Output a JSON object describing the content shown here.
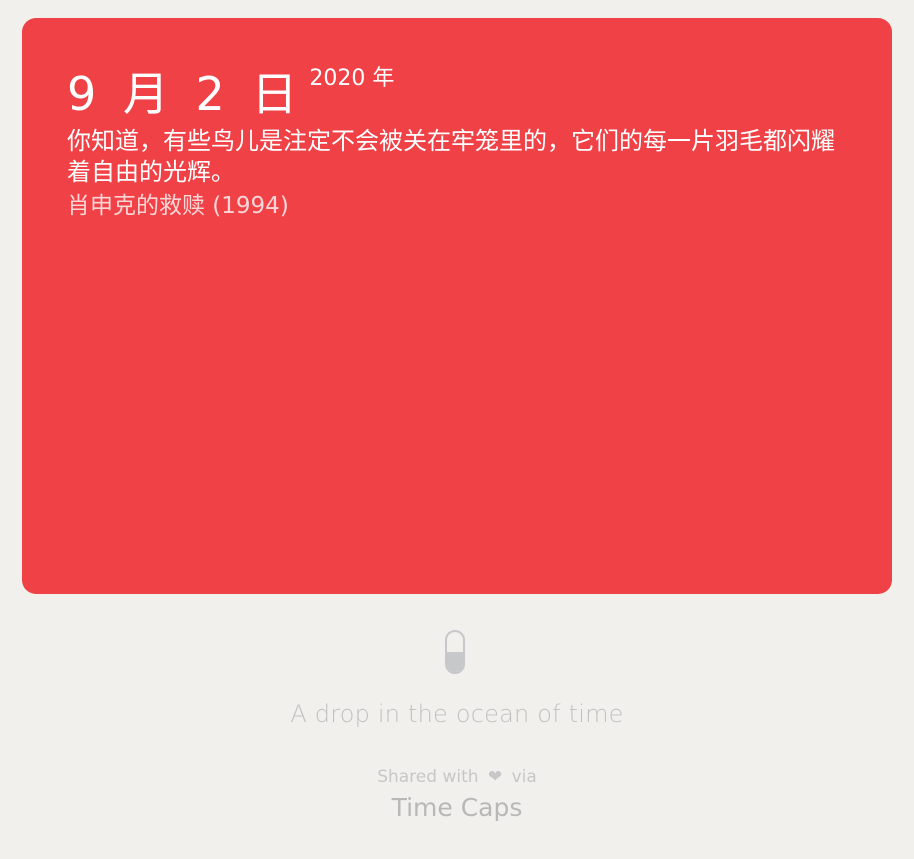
{
  "card": {
    "background": "#ef4146",
    "date": {
      "main": "9 月 2 日",
      "year": "2020 年"
    },
    "quote": "你知道，有些鸟儿是注定不会被关在牢笼里的，它们的每一片羽毛都闪耀着自由的光辉。",
    "source": "肖申克的救赎 (1994)"
  },
  "footer": {
    "tagline": "A drop in the ocean of time",
    "shared_prefix": "Shared with",
    "heart": "❤",
    "shared_suffix": "via",
    "brand": "Time Caps",
    "pill_icon_color": "#c7c8c9",
    "text_color": "#c1c1c1"
  }
}
